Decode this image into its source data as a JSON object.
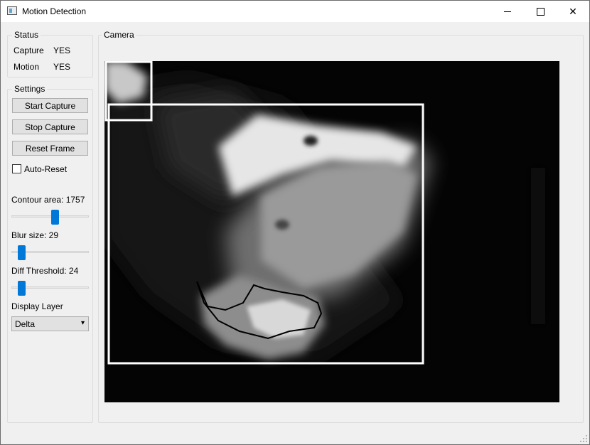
{
  "window": {
    "title": "Motion Detection",
    "minimize_icon": "minimize-icon",
    "maximize_icon": "maximize-icon",
    "close_icon": "close-icon",
    "close_glyph": "✕"
  },
  "status": {
    "group_title": "Status",
    "rows": [
      {
        "label": "Capture",
        "value": "YES"
      },
      {
        "label": "Motion",
        "value": "YES"
      }
    ]
  },
  "settings": {
    "group_title": "Settings",
    "buttons": {
      "start_capture": "Start Capture",
      "stop_capture": "Stop Capture",
      "reset_frame": "Reset Frame"
    },
    "auto_reset": {
      "label": "Auto-Reset",
      "checked": false
    },
    "sliders": [
      {
        "label": "Contour area: 1757",
        "level_fraction": 0.55
      },
      {
        "label": "Blur size: 29",
        "level_fraction": 0.1
      },
      {
        "label": "Diff Threshold: 24",
        "level_fraction": 0.1
      }
    ],
    "display_layer": {
      "label": "Display Layer",
      "selected": "Delta",
      "arrow_glyph": "▾"
    }
  },
  "camera": {
    "group_title": "Camera",
    "bbox_color": "#ffffff",
    "slider_color": "#0078d7"
  }
}
